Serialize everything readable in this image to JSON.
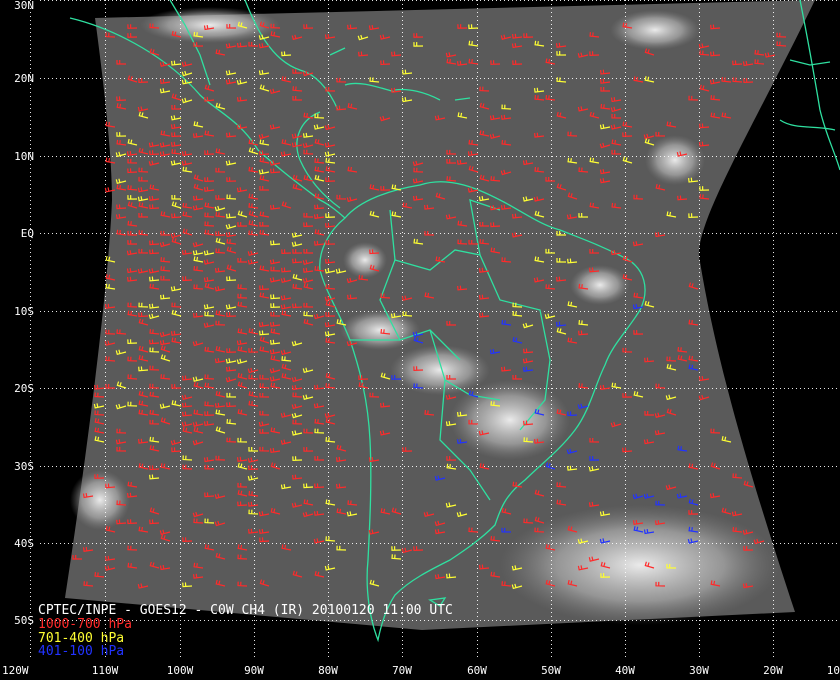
{
  "product": {
    "title": "CPTEC/INPE - GOES12 - C0W CH4 (IR) 20100120 11:00 UTC"
  },
  "legend": [
    {
      "label": "1000-700 hPa",
      "color": "#ff2a2a"
    },
    {
      "label": "701-400 hPa",
      "color": "#ffff33"
    },
    {
      "label": "401-100 hPa",
      "color": "#2233ff"
    }
  ],
  "latitude_labels": [
    "30N",
    "20N",
    "10N",
    "EQ",
    "10S",
    "20S",
    "30S",
    "40S",
    "50S"
  ],
  "longitude_labels": [
    "120W",
    "110W",
    "100W",
    "90W",
    "80W",
    "70W",
    "60W",
    "50W",
    "40W",
    "30W",
    "20W",
    "10"
  ],
  "colors": {
    "background": "#000000",
    "coastline": "#2fe0a0",
    "grid": "#ffffff",
    "imagery": "#5a5a5a"
  }
}
